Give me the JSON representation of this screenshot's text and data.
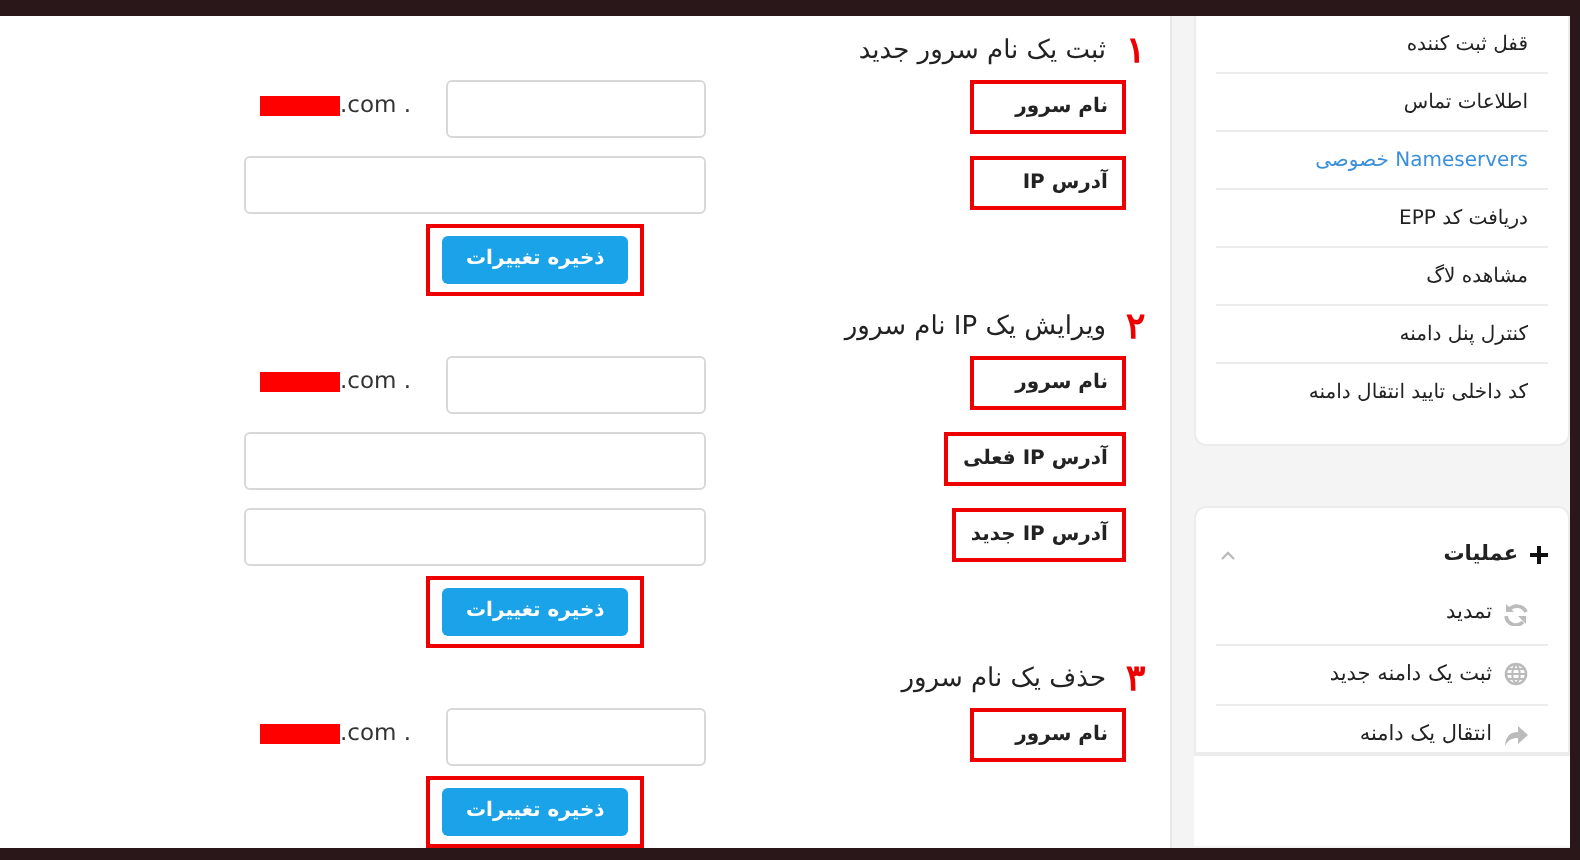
{
  "sections": [
    {
      "number": "۱",
      "title": "ثبت یک نام سرور جدید",
      "fields": [
        {
          "kind": "domain",
          "label": "نام سرور",
          "suffix": ".com .",
          "highlighted": true
        },
        {
          "kind": "ip",
          "label": "آدرس IP",
          "highlighted": true
        }
      ],
      "button": {
        "label": "ذخیره تغییرات",
        "highlighted": true
      }
    },
    {
      "number": "۲",
      "title": "ویرایش یک IP نام سرور",
      "fields": [
        {
          "kind": "domain",
          "label": "نام سرور",
          "suffix": ".com .",
          "highlighted": true
        },
        {
          "kind": "ip",
          "label": "آدرس IP فعلی",
          "highlighted": true
        },
        {
          "kind": "ip",
          "label": "آدرس IP جدید",
          "highlighted": true
        }
      ],
      "button": {
        "label": "ذخیره تغییرات",
        "highlighted": true
      }
    },
    {
      "number": "۳",
      "title": "حذف یک نام سرور",
      "fields": [
        {
          "kind": "domain",
          "label": "نام سرور",
          "suffix": ".com .",
          "highlighted": true
        }
      ],
      "button": {
        "label": "ذخیره تغییرات",
        "highlighted": true
      }
    }
  ],
  "sidebar": {
    "menu": [
      {
        "label": "قفل ثبت کننده",
        "selected": false
      },
      {
        "label": "اطلاعات تماس",
        "selected": false
      },
      {
        "label": "Nameservers خصوصی",
        "selected": true
      },
      {
        "label": "دریافت کد EPP",
        "selected": false
      },
      {
        "label": "مشاهده لاگ",
        "selected": false
      },
      {
        "label": "کنترل پنل دامنه",
        "selected": false
      },
      {
        "label": "کد داخلی تایید انتقال دامنه",
        "selected": false
      }
    ],
    "actions": {
      "title": "عملیات",
      "expanded": true,
      "items": [
        {
          "kind": "renew",
          "label": "تمدید"
        },
        {
          "kind": "globe",
          "label": "ثبت یک دامنه جدید"
        },
        {
          "kind": "transfer",
          "label": "انتقال یک دامنه"
        }
      ]
    }
  }
}
